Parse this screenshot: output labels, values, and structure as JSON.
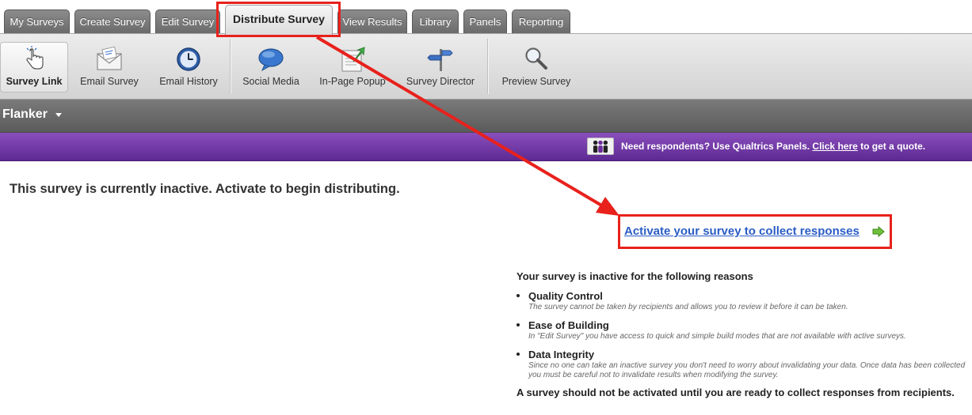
{
  "tabs": [
    {
      "label": "My Surveys"
    },
    {
      "label": "Create Survey"
    },
    {
      "label": "Edit Survey"
    },
    {
      "label": "Distribute Survey"
    },
    {
      "label": "View Results"
    },
    {
      "label": "Library"
    },
    {
      "label": "Panels"
    },
    {
      "label": "Reporting"
    }
  ],
  "toolbar": {
    "items": [
      {
        "label": "Survey Link",
        "icon": "pointing-hand-icon"
      },
      {
        "label": "Email Survey",
        "icon": "envelope-icon"
      },
      {
        "label": "Email History",
        "icon": "clock-icon"
      },
      {
        "label": "Social Media",
        "icon": "speech-bubble-icon"
      },
      {
        "label": "In-Page Popup",
        "icon": "popup-page-icon"
      },
      {
        "label": "Survey Director",
        "icon": "signpost-icon"
      },
      {
        "label": "Preview Survey",
        "icon": "magnifier-icon"
      }
    ]
  },
  "survey": {
    "name": "Flanker"
  },
  "promo": {
    "text_before": "Need respondents? Use Qualtrics Panels.",
    "link": "Click here",
    "text_after": "to get a quote."
  },
  "main": {
    "inactive_message": "This survey is currently inactive. Activate to begin distributing.",
    "activate_link": "Activate your survey to collect responses",
    "reasons_heading": "Your survey is inactive for the following reasons",
    "reasons": [
      {
        "title": "Quality Control",
        "desc": "The survey cannot be taken by recipients and allows you to review it before it can be taken."
      },
      {
        "title": "Ease of Building",
        "desc": "In \"Edit Survey\" you have access to quick and simple build modes that are not available with active surveys."
      },
      {
        "title": "Data Integrity",
        "desc": "Since no one can take an inactive survey you don't need to worry about invalidating your data. Once data has been collected you must be careful not to invalidate results when modifying the survey."
      }
    ],
    "footer_note": "A survey should not be activated until you are ready to collect responses from recipients."
  },
  "colors": {
    "accent_red": "#e8211c",
    "link_blue": "#2a5cc4",
    "promo_purple": "#6b339f"
  }
}
